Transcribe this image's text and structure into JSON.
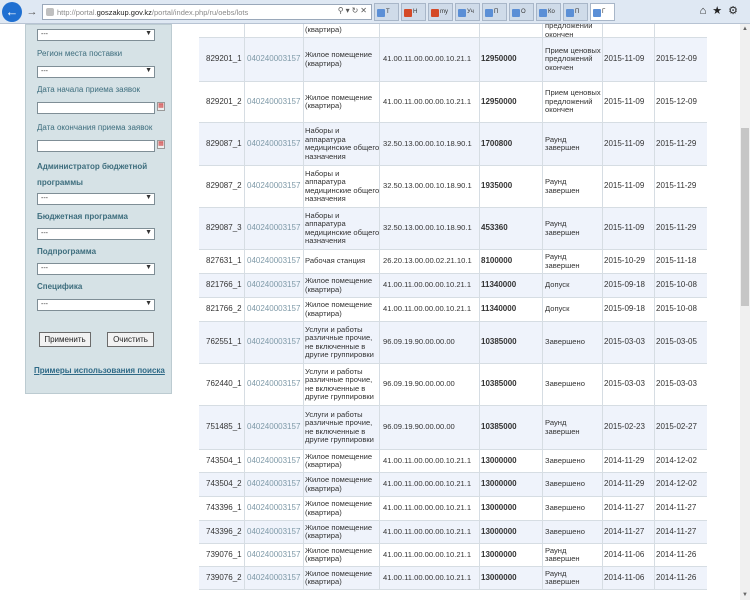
{
  "browser": {
    "url_prefix": "http://portal.",
    "url_domain": "goszakup.gov.kz",
    "url_rest": "/portal/index.php/ru/oebs/lots",
    "tabs": [
      "Т",
      "Н",
      "my",
      "Уч",
      "П",
      "О",
      "Ко",
      "П",
      "Г"
    ],
    "icons": [
      "home-icon",
      "star-icon",
      "gear-icon"
    ]
  },
  "filters": {
    "first_select_value": "---",
    "region_label": "Регион места поставки",
    "region_value": "---",
    "start_date_label": "Дата начала приема заявок",
    "start_date_value": "",
    "end_date_label": "Дата окончания приема заявок",
    "end_date_value": "",
    "admin_label_1": "Администратор бюджетной",
    "admin_label_2": "программы",
    "admin_value": "---",
    "budget_label": "Бюджетная программа",
    "budget_value": "---",
    "subprogram_label": "Подпрограмма",
    "subprogram_value": "---",
    "specific_label": "Специфика",
    "specific_value": "---",
    "apply_button": "Применить",
    "clear_button": "Очистить",
    "help_link": "Примеры использования поиска"
  },
  "table": {
    "rows": [
      {
        "id": "",
        "bin": "",
        "name": "(квартира)",
        "code": "",
        "sum": "",
        "status": "предложений окончен",
        "d1": "",
        "d2": ""
      },
      {
        "id": "829201_1",
        "bin": "040240003157",
        "name": "Жилое помещение (квартира)",
        "code": "41.00.11.00.00.00.10.21.1",
        "sum": "12950000",
        "status": "Прием ценовых предложений окончен",
        "d1": "2015-11-09",
        "d2": "2015-12-09"
      },
      {
        "id": "829201_2",
        "bin": "040240003157",
        "name": "Жилое помещение (квартира)",
        "code": "41.00.11.00.00.00.10.21.1",
        "sum": "12950000",
        "status": "Прием ценовых предложений окончен",
        "d1": "2015-11-09",
        "d2": "2015-12-09"
      },
      {
        "id": "829087_1",
        "bin": "040240003157",
        "name": "Наборы и аппаратура медицинские общего назначения",
        "code": "32.50.13.00.00.10.18.90.1",
        "sum": "1700800",
        "status": "Раунд завершен",
        "d1": "2015-11-09",
        "d2": "2015-11-29"
      },
      {
        "id": "829087_2",
        "bin": "040240003157",
        "name": "Наборы и аппаратура медицинские общего назначения",
        "code": "32.50.13.00.00.10.18.90.1",
        "sum": "1935000",
        "status": "Раунд завершен",
        "d1": "2015-11-09",
        "d2": "2015-11-29"
      },
      {
        "id": "829087_3",
        "bin": "040240003157",
        "name": "Наборы и аппаратура медицинские общего назначения",
        "code": "32.50.13.00.00.10.18.90.1",
        "sum": "453360",
        "status": "Раунд завершен",
        "d1": "2015-11-09",
        "d2": "2015-11-29"
      },
      {
        "id": "827631_1",
        "bin": "040240003157",
        "name": "Рабочая станция",
        "code": "26.20.13.00.00.02.21.10.1",
        "sum": "8100000",
        "status": "Раунд завершен",
        "d1": "2015-10-29",
        "d2": "2015-11-18"
      },
      {
        "id": "821766_1",
        "bin": "040240003157",
        "name": "Жилое помещение (квартира)",
        "code": "41.00.11.00.00.00.10.21.1",
        "sum": "11340000",
        "status": "Допуск",
        "d1": "2015-09-18",
        "d2": "2015-10-08"
      },
      {
        "id": "821766_2",
        "bin": "040240003157",
        "name": "Жилое помещение (квартира)",
        "code": "41.00.11.00.00.00.10.21.1",
        "sum": "11340000",
        "status": "Допуск",
        "d1": "2015-09-18",
        "d2": "2015-10-08"
      },
      {
        "id": "762551_1",
        "bin": "040240003157",
        "name": "Услуги и работы различные прочие, не включенные в другие группировки",
        "code": "96.09.19.90.00.00.00",
        "sum": "10385000",
        "status": "Завершено",
        "d1": "2015-03-03",
        "d2": "2015-03-05"
      },
      {
        "id": "762440_1",
        "bin": "040240003157",
        "name": "Услуги и работы различные прочие, не включенные в другие группировки",
        "code": "96.09.19.90.00.00.00",
        "sum": "10385000",
        "status": "Завершено",
        "d1": "2015-03-03",
        "d2": "2015-03-03"
      },
      {
        "id": "751485_1",
        "bin": "040240003157",
        "name": "Услуги и работы различные прочие, не включенные в другие группировки",
        "code": "96.09.19.90.00.00.00",
        "sum": "10385000",
        "status": "Раунд завершен",
        "d1": "2015-02-23",
        "d2": "2015-02-27"
      },
      {
        "id": "743504_1",
        "bin": "040240003157",
        "name": "Жилое помещение (квартира)",
        "code": "41.00.11.00.00.00.10.21.1",
        "sum": "13000000",
        "status": "Завершено",
        "d1": "2014-11-29",
        "d2": "2014-12-02"
      },
      {
        "id": "743504_2",
        "bin": "040240003157",
        "name": "Жилое помещение (квартира)",
        "code": "41.00.11.00.00.00.10.21.1",
        "sum": "13000000",
        "status": "Завершено",
        "d1": "2014-11-29",
        "d2": "2014-12-02"
      },
      {
        "id": "743396_1",
        "bin": "040240003157",
        "name": "Жилое помещение (квартира)",
        "code": "41.00.11.00.00.00.10.21.1",
        "sum": "13000000",
        "status": "Завершено",
        "d1": "2014-11-27",
        "d2": "2014-11-27"
      },
      {
        "id": "743396_2",
        "bin": "040240003157",
        "name": "Жилое помещение (квартира)",
        "code": "41.00.11.00.00.00.10.21.1",
        "sum": "13000000",
        "status": "Завершено",
        "d1": "2014-11-27",
        "d2": "2014-11-27"
      },
      {
        "id": "739076_1",
        "bin": "040240003157",
        "name": "Жилое помещение (квартира)",
        "code": "41.00.11.00.00.00.10.21.1",
        "sum": "13000000",
        "status": "Раунд завершен",
        "d1": "2014-11-06",
        "d2": "2014-11-26"
      },
      {
        "id": "739076_2",
        "bin": "040240003157",
        "name": "Жилое помещение (квартира)",
        "code": "41.00.11.00.00.00.10.21.1",
        "sum": "13000000",
        "status": "Раунд завершен",
        "d1": "2014-11-06",
        "d2": "2014-11-26"
      }
    ]
  }
}
